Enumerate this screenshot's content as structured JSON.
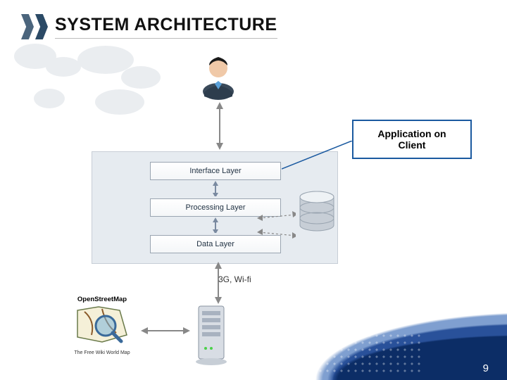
{
  "header": {
    "title": "SYSTEM ARCHITECTURE"
  },
  "labels": {
    "client": "Application on Client"
  },
  "layers": {
    "l1": "Interface Layer",
    "l2": "Processing Layer",
    "l3": "Data Layer"
  },
  "network": "3G, Wi-fi",
  "osm": {
    "title": "OpenStreetMap",
    "subtitle": "The Free Wiki World Map"
  },
  "icons": {
    "user": "user-icon",
    "database": "database-icon",
    "server": "server-icon",
    "map": "map-icon",
    "chevron": "chevron-icon"
  },
  "colors": {
    "accent": "#1b5aa0",
    "header_dark": "#2b4a66",
    "footer1": "#0c2d66",
    "footer2": "#1a4390",
    "footer3": "#2a5fb0",
    "layer_bg": "#e6ebf0"
  },
  "page_number": "9"
}
